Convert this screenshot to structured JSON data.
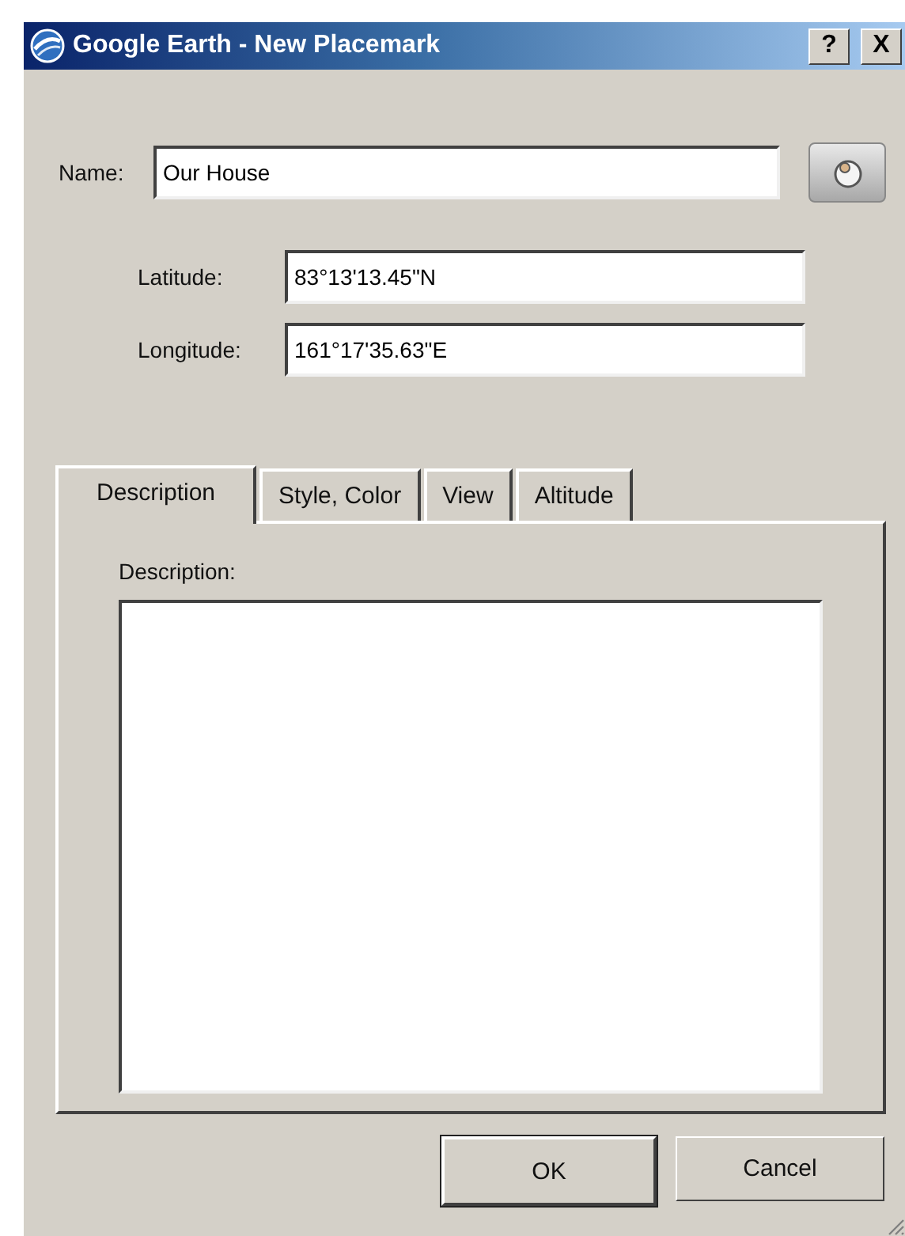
{
  "window": {
    "title": "Google Earth - New Placemark",
    "buttons": [
      "?",
      "X"
    ]
  },
  "name": {
    "label": "Name:",
    "value": "Our House"
  },
  "coordinates": [
    {
      "label": "Latitude:",
      "value": "83°13'13.45\"N"
    },
    {
      "label": "Longitude:",
      "value": "161°17'35.63\"E"
    }
  ],
  "tabs": [
    {
      "label": "Description",
      "selected": true
    },
    {
      "label": "Style, Color",
      "selected": false
    },
    {
      "label": "View",
      "selected": false
    },
    {
      "label": "Altitude",
      "selected": false
    }
  ],
  "description": {
    "label": "Description:"
  },
  "buttons": [
    {
      "label": "OK",
      "default": true
    },
    {
      "label": "Cancel",
      "default": false
    }
  ]
}
